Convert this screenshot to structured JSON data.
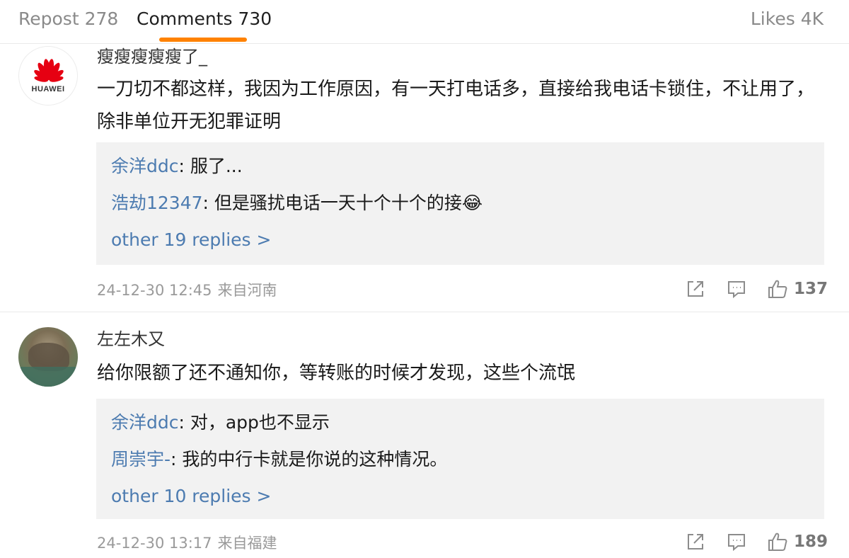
{
  "tabs": {
    "repost": "Repost 278",
    "comments": "Comments 730",
    "likes": "Likes 4K",
    "accent_color": "#ff8200"
  },
  "comments": [
    {
      "avatar": {
        "logo_text": "HUAWEI",
        "icon": "huawei-logo-icon"
      },
      "username": "瘦瘦瘦瘦瘦了_",
      "text": "一刀切不都这样，我因为工作原因，有一天打电话多，直接给我电话卡锁住，不让用了，除非单位开无犯罪证明",
      "replies": [
        {
          "name": "余洋ddc",
          "text": ": 服了..."
        },
        {
          "name": "浩劫12347",
          "text": ": 但是骚扰电话一天十个十个的接😂"
        }
      ],
      "more_replies": "other 19 replies >",
      "time": "24-12-30 12:45",
      "location": "来自河南",
      "likes": "137"
    },
    {
      "avatar": {
        "icon": "landscape-photo-avatar"
      },
      "username": "左左木又",
      "text": "给你限额了还不通知你，等转账的时候才发现，这些个流氓",
      "replies": [
        {
          "name": "余洋ddc",
          "text": ": 对，app也不显示"
        },
        {
          "name": "周崇宇-",
          "text": ": 我的中行卡就是你说的这种情况。"
        }
      ],
      "more_replies": "other 10 replies >",
      "time": "24-12-30 13:17",
      "location": "来自福建",
      "likes": "189"
    }
  ],
  "colors": {
    "link": "#4c7bb0",
    "meta": "#9a9a9a",
    "reply_background": "#f2f2f2",
    "huawei_red": "#e60012"
  }
}
